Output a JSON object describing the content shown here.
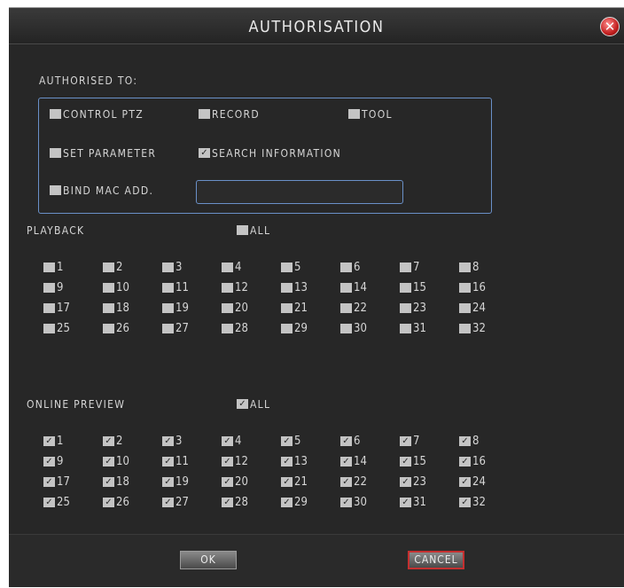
{
  "dialog": {
    "title": "AUTHORISATION",
    "close_icon": "close-icon",
    "authorised_to_label": "AUTHORISED TO:",
    "options": {
      "control_ptz": {
        "label": "CONTROL PTZ",
        "checked": false
      },
      "record": {
        "label": "RECORD",
        "checked": false
      },
      "tool": {
        "label": "TOOL",
        "checked": false
      },
      "set_parameter": {
        "label": "SET PARAMETER",
        "checked": false
      },
      "search_information": {
        "label": "SEARCH INFORMATION",
        "checked": true
      },
      "bind_mac": {
        "label": "BIND MAC ADD.",
        "checked": false,
        "value": ""
      }
    },
    "playback": {
      "label": "PLAYBACK",
      "all_label": "ALL",
      "all_checked": false,
      "checked": false,
      "channels": [
        "1",
        "2",
        "3",
        "4",
        "5",
        "6",
        "7",
        "8",
        "9",
        "10",
        "11",
        "12",
        "13",
        "14",
        "15",
        "16",
        "17",
        "18",
        "19",
        "20",
        "21",
        "22",
        "23",
        "24",
        "25",
        "26",
        "27",
        "28",
        "29",
        "30",
        "31",
        "32"
      ]
    },
    "online_preview": {
      "label": "ONLINE PREVIEW",
      "all_label": "ALL",
      "all_checked": true,
      "checked": true,
      "channels": [
        "1",
        "2",
        "3",
        "4",
        "5",
        "6",
        "7",
        "8",
        "9",
        "10",
        "11",
        "12",
        "13",
        "14",
        "15",
        "16",
        "17",
        "18",
        "19",
        "20",
        "21",
        "22",
        "23",
        "24",
        "25",
        "26",
        "27",
        "28",
        "29",
        "30",
        "31",
        "32"
      ]
    },
    "buttons": {
      "ok": "OK",
      "cancel": "CANCEL"
    },
    "colors": {
      "background": "#272727",
      "accent_border": "#6a90c8",
      "cancel_border": "#c43030"
    }
  }
}
